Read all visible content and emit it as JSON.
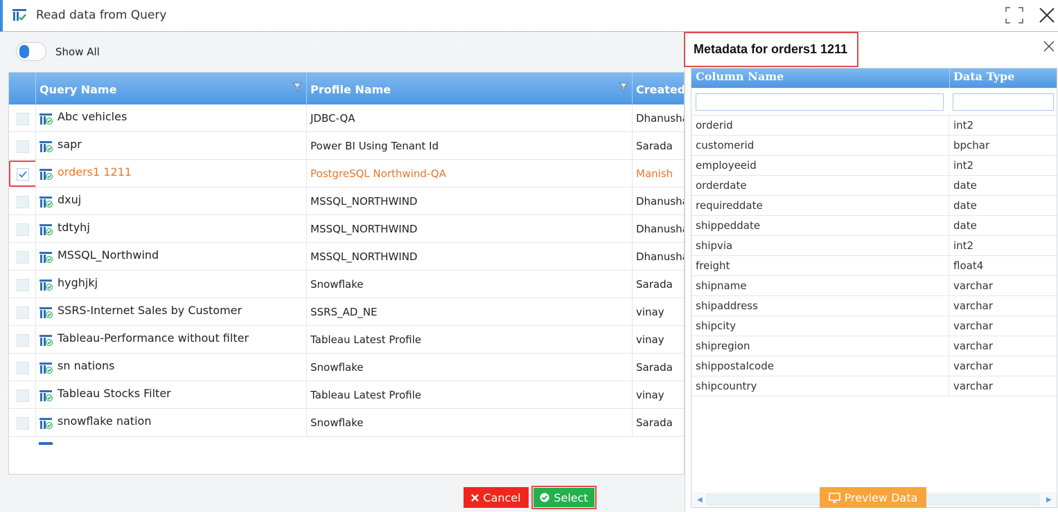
{
  "window": {
    "title": "Read data from Query"
  },
  "toolbar": {
    "show_all_label": "Show All",
    "show_all_on": true
  },
  "grid": {
    "columns": [
      "Query Name",
      "Profile Name",
      "Created"
    ],
    "rows": [
      {
        "name": "Abc vehicles",
        "profile": "JDBC-QA",
        "created": "Dhanusha",
        "checked": false
      },
      {
        "name": "sapr",
        "profile": "Power BI Using Tenant Id",
        "created": "Sarada",
        "checked": false
      },
      {
        "name": "orders1 1211",
        "profile": "PostgreSQL Northwind-QA",
        "created": "Manish",
        "checked": true
      },
      {
        "name": "dxuj",
        "profile": "MSSQL_NORTHWIND",
        "created": "Dhanusha",
        "checked": false
      },
      {
        "name": "tdtyhj",
        "profile": "MSSQL_NORTHWIND",
        "created": "Dhanusha",
        "checked": false
      },
      {
        "name": "MSSQL_Northwind",
        "profile": "MSSQL_NORTHWIND",
        "created": "Dhanusha",
        "checked": false
      },
      {
        "name": "hyghjkj",
        "profile": "Snowflake",
        "created": "Sarada",
        "checked": false
      },
      {
        "name": "SSRS-Internet Sales by Customer",
        "profile": "SSRS_AD_NE",
        "created": "vinay",
        "checked": false
      },
      {
        "name": "Tableau-Performance without filter",
        "profile": "Tableau Latest Profile",
        "created": "vinay",
        "checked": false
      },
      {
        "name": "sn nations",
        "profile": "Snowflake",
        "created": "Sarada",
        "checked": false
      },
      {
        "name": "Tableau Stocks Filter",
        "profile": "Tableau Latest Profile",
        "created": "vinay",
        "checked": false
      },
      {
        "name": "snowflake nation",
        "profile": "Snowflake",
        "created": "Sarada",
        "checked": false
      }
    ]
  },
  "buttons": {
    "cancel": "Cancel",
    "select": "Select",
    "preview": "Preview Data"
  },
  "metadata": {
    "title": "Metadata for orders1 1211",
    "columns": [
      "Column Name",
      "Data Type"
    ],
    "rows": [
      {
        "column": "orderid",
        "type": "int2"
      },
      {
        "column": "customerid",
        "type": "bpchar"
      },
      {
        "column": "employeeid",
        "type": "int2"
      },
      {
        "column": "orderdate",
        "type": "date"
      },
      {
        "column": "requireddate",
        "type": "date"
      },
      {
        "column": "shippeddate",
        "type": "date"
      },
      {
        "column": "shipvia",
        "type": "int2"
      },
      {
        "column": "freight",
        "type": "float4"
      },
      {
        "column": "shipname",
        "type": "varchar"
      },
      {
        "column": "shipaddress",
        "type": "varchar"
      },
      {
        "column": "shipcity",
        "type": "varchar"
      },
      {
        "column": "shipregion",
        "type": "varchar"
      },
      {
        "column": "shippostalcode",
        "type": "varchar"
      },
      {
        "column": "shipcountry",
        "type": "varchar"
      }
    ]
  },
  "colors": {
    "accent": "#3b8de0",
    "header_blue": "#4d97e3",
    "selected_text": "#e8762e",
    "cancel": "#f0261c",
    "select": "#22b14c",
    "preview": "#f8a43a",
    "highlight": "#e34b4b"
  },
  "icons": {
    "query": "query-report-icon",
    "filter": "funnel-icon",
    "maximize": "maximize-icon",
    "close": "close-icon"
  }
}
